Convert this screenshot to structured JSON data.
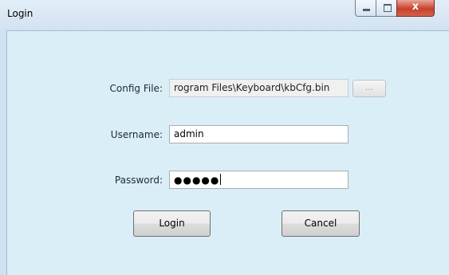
{
  "window": {
    "title": "Login",
    "minimize_icon": "minimize-icon",
    "maximize_icon": "maximize-icon",
    "close_icon": "close-icon",
    "close_glyph": "x"
  },
  "form": {
    "config_file": {
      "label": "Config File:",
      "value": "rogram Files\\Keyboard\\kbCfg.bin",
      "browse_label": "..."
    },
    "username": {
      "label": "Username:",
      "value": "admin"
    },
    "password": {
      "label": "Password:",
      "masked_value": "●●●●●"
    }
  },
  "actions": {
    "login_label": "Login",
    "cancel_label": "Cancel"
  },
  "colors": {
    "client_background": "#daeef8",
    "title_background": "#d2e2f0",
    "close_button": "#c7412b"
  }
}
